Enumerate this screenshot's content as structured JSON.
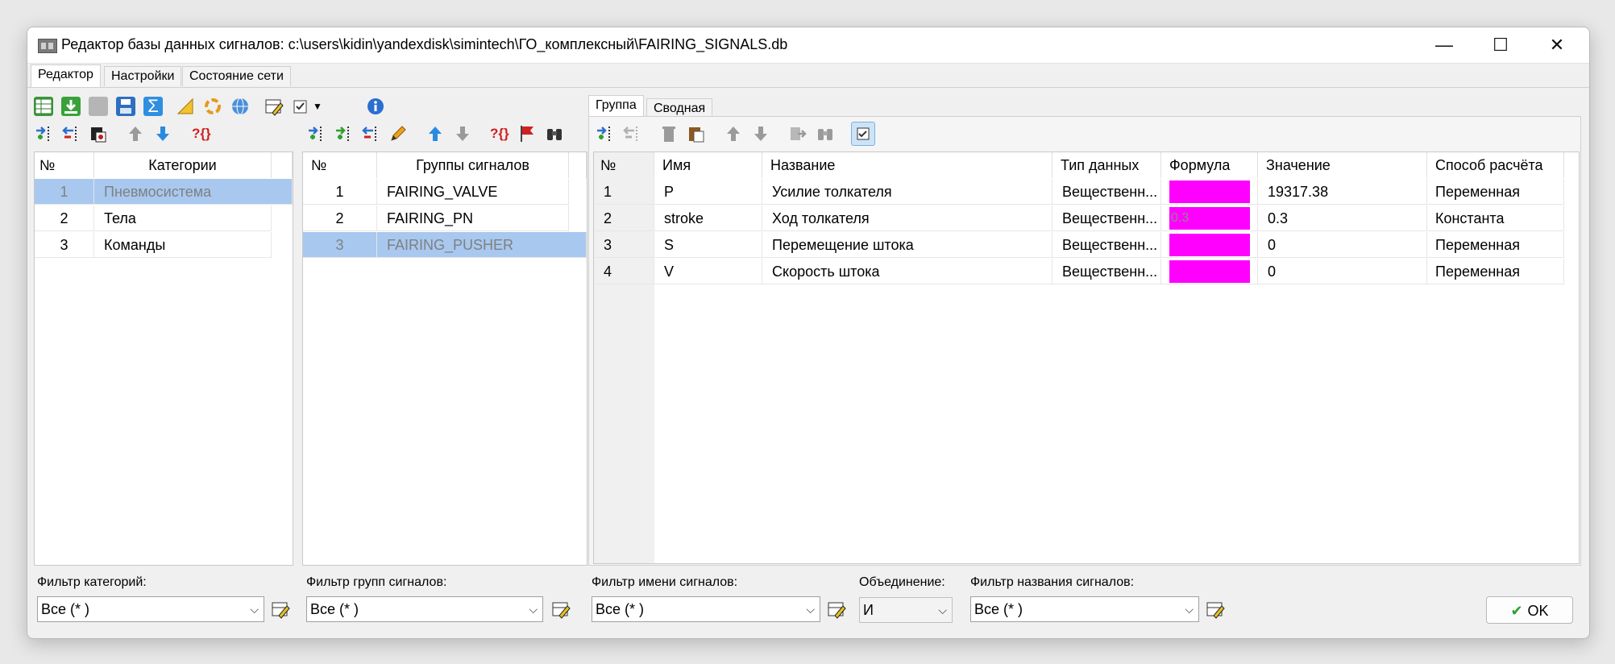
{
  "window": {
    "title": "Редактор базы данных сигналов: c:\\users\\kidin\\yandexdisk\\simintech\\ГО_комплексный\\FAIRING_SIGNALS.db",
    "min_glyph": "—",
    "max_glyph": "☐",
    "close_glyph": "✕"
  },
  "top_tabs": [
    "Редактор",
    "Настройки",
    "Состояние сети"
  ],
  "categories": {
    "headers": [
      "№",
      "Категории"
    ],
    "rows": [
      {
        "num": "1",
        "name": "Пневмосистема",
        "selected": true
      },
      {
        "num": "2",
        "name": "Тела",
        "selected": false
      },
      {
        "num": "3",
        "name": "Команды",
        "selected": false
      }
    ],
    "filter_label": "Фильтр категорий:",
    "filter_value": "Все (* )"
  },
  "groups": {
    "headers": [
      "№",
      "Группы сигналов"
    ],
    "rows": [
      {
        "num": "1",
        "name": "FAIRING_VALVE",
        "selected": false
      },
      {
        "num": "2",
        "name": "FAIRING_PN",
        "selected": false
      },
      {
        "num": "3",
        "name": "FAIRING_PUSHER",
        "selected": true
      }
    ],
    "filter_label": "Фильтр групп сигналов:",
    "filter_value": "Все (* )"
  },
  "signals": {
    "tabs": [
      "Группа",
      "Сводная"
    ],
    "headers": [
      "№",
      "Имя",
      "Название",
      "Тип данных",
      "Формула",
      "Значение",
      "Способ расчёта"
    ],
    "rows": [
      {
        "num": "1",
        "name": "P",
        "title": "Усилие толкателя",
        "type": "Вещественн...",
        "formula": "",
        "value": "19317.38",
        "method": "Переменная"
      },
      {
        "num": "2",
        "name": "stroke",
        "title": "Ход толкателя",
        "type": "Вещественн...",
        "formula": "0.3",
        "value": "0.3",
        "method": "Константа"
      },
      {
        "num": "3",
        "name": "S",
        "title": "Перемещение штока",
        "type": "Вещественн...",
        "formula": "",
        "value": "0",
        "method": "Переменная"
      },
      {
        "num": "4",
        "name": "V",
        "title": "Скорость штока",
        "type": "Вещественн...",
        "formula": "",
        "value": "0",
        "method": "Переменная"
      }
    ],
    "name_filter_label": "Фильтр имени сигналов:",
    "name_filter_value": "Все (* )",
    "union_label": "Объединение:",
    "union_value": "И",
    "title_filter_label": "Фильтр названия сигналов:",
    "title_filter_value": "Все (* )"
  },
  "ok_label": "OK",
  "colors": {
    "formula_bg": "#ff00ff",
    "selection": "#a8c8ef",
    "accent": "#2a7de1"
  }
}
